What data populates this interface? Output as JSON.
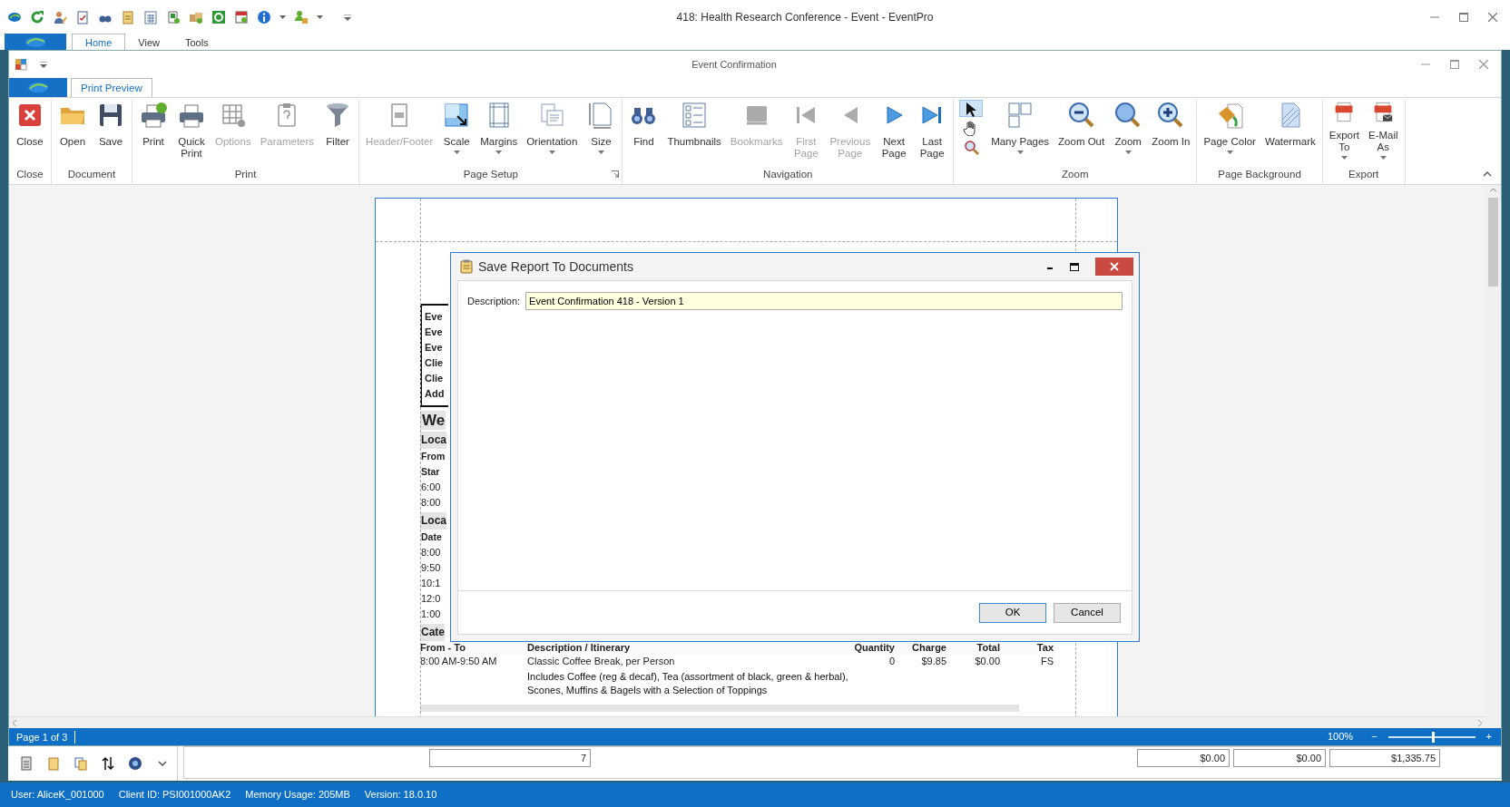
{
  "app": {
    "title": "418: Health Research Conference - Event - EventPro",
    "tabs": [
      {
        "label": "Home",
        "selected": true
      },
      {
        "label": "View",
        "selected": false
      },
      {
        "label": "Tools",
        "selected": false
      }
    ]
  },
  "window": {
    "title": "Event Confirmation",
    "tabs": [
      {
        "label": "Print Preview",
        "selected": true
      }
    ]
  },
  "ribbon": {
    "groups": [
      {
        "label": "Close",
        "launcher": false,
        "buttons": [
          {
            "kind": "large",
            "label": "Close",
            "disabled": false,
            "dropdown": false
          }
        ]
      },
      {
        "label": "Document",
        "launcher": false,
        "buttons": [
          {
            "kind": "large",
            "label": "Open",
            "disabled": false,
            "dropdown": false
          },
          {
            "kind": "large",
            "label": "Save",
            "disabled": false,
            "dropdown": false
          }
        ]
      },
      {
        "label": "Print",
        "launcher": false,
        "buttons": [
          {
            "kind": "large",
            "label": "Print",
            "disabled": false,
            "dropdown": false
          },
          {
            "kind": "large",
            "label": "Quick\nPrint",
            "disabled": false,
            "dropdown": false
          },
          {
            "kind": "large",
            "label": "Options",
            "disabled": true,
            "dropdown": false
          },
          {
            "kind": "large",
            "label": "Parameters",
            "disabled": true,
            "dropdown": false
          },
          {
            "kind": "large",
            "label": "Filter",
            "disabled": false,
            "dropdown": false
          }
        ]
      },
      {
        "label": "Page Setup",
        "launcher": true,
        "buttons": [
          {
            "kind": "large",
            "label": "Header/Footer",
            "disabled": true,
            "dropdown": false
          },
          {
            "kind": "large",
            "label": "Scale",
            "disabled": false,
            "dropdown": true
          },
          {
            "kind": "large",
            "label": "Margins",
            "disabled": false,
            "dropdown": true
          },
          {
            "kind": "large",
            "label": "Orientation",
            "disabled": false,
            "dropdown": true
          },
          {
            "kind": "large",
            "label": "Size",
            "disabled": false,
            "dropdown": true
          }
        ]
      },
      {
        "label": "Navigation",
        "launcher": false,
        "buttons": [
          {
            "kind": "large",
            "label": "Find",
            "disabled": false,
            "dropdown": false
          },
          {
            "kind": "large",
            "label": "Thumbnails",
            "disabled": false,
            "dropdown": false
          },
          {
            "kind": "large",
            "label": "Bookmarks",
            "disabled": true,
            "dropdown": false
          },
          {
            "kind": "large",
            "label": "First\nPage",
            "disabled": true,
            "dropdown": false
          },
          {
            "kind": "large",
            "label": "Previous\nPage",
            "disabled": true,
            "dropdown": false
          },
          {
            "kind": "large",
            "label": "Next\nPage",
            "disabled": false,
            "dropdown": false
          },
          {
            "kind": "large",
            "label": "Last\nPage",
            "disabled": false,
            "dropdown": false
          }
        ]
      },
      {
        "label": "Zoom",
        "launcher": false,
        "buttons": [
          {
            "kind": "tools",
            "tools": [
              {
                "selected": true
              },
              {
                "selected": false
              },
              {
                "selected": false
              }
            ]
          },
          {
            "kind": "large",
            "label": "Many Pages",
            "disabled": false,
            "dropdown": true
          },
          {
            "kind": "large",
            "label": "Zoom Out",
            "disabled": false,
            "dropdown": false
          },
          {
            "kind": "large",
            "label": "Zoom",
            "disabled": false,
            "dropdown": true
          },
          {
            "kind": "large",
            "label": "Zoom In",
            "disabled": false,
            "dropdown": false
          }
        ]
      },
      {
        "label": "Page Background",
        "launcher": false,
        "buttons": [
          {
            "kind": "large",
            "label": "Page Color",
            "disabled": false,
            "dropdown": true
          },
          {
            "kind": "large",
            "label": "Watermark",
            "disabled": false,
            "dropdown": false
          }
        ]
      },
      {
        "label": "Export",
        "launcher": false,
        "buttons": [
          {
            "kind": "large",
            "label": "Export\nTo",
            "disabled": false,
            "dropdown": true
          },
          {
            "kind": "large",
            "label": "E-Mail\nAs",
            "disabled": false,
            "dropdown": true
          }
        ]
      }
    ]
  },
  "page": {
    "info_box": [
      "Eve",
      "Eve",
      "Eve",
      "Clie",
      "Clie",
      "Add"
    ],
    "section": "We",
    "lines": [
      {
        "kind": "subheading",
        "text": "Loca"
      },
      {
        "kind": "label",
        "text": "From"
      },
      {
        "kind": "label",
        "text": "Star"
      },
      {
        "kind": "plain",
        "text": "6:00"
      },
      {
        "kind": "plain",
        "text": "8:00"
      },
      {
        "kind": "subheading",
        "text": "Loca"
      },
      {
        "kind": "label",
        "text": "Date"
      },
      {
        "kind": "plain",
        "text": "8:00"
      },
      {
        "kind": "plain",
        "text": "9:50"
      },
      {
        "kind": "plain",
        "text": "10:1"
      },
      {
        "kind": "plain",
        "text": "12:0"
      },
      {
        "kind": "plain",
        "text": "1:00"
      },
      {
        "kind": "subheading",
        "text": "Cate"
      }
    ],
    "table": {
      "columns": [
        "From - To",
        "Description / Itinerary",
        "Quantity",
        "Charge",
        "Total",
        "Tax"
      ],
      "rows": [
        {
          "cells": [
            "8:00 AM-9:50 AM",
            "Classic Coffee Break, per Person",
            "0",
            "$9.85",
            "$0.00",
            "FS"
          ],
          "note": "Includes Coffee (reg & decaf), Tea (assortment of black, green & herbal),\nScones, Muffins & Bagels with a Selection of Toppings"
        }
      ]
    }
  },
  "dialog": {
    "title": "Save Report To Documents",
    "field": {
      "label": "Description:",
      "value": "Event Confirmation 418 - Version 1"
    },
    "buttons": [
      {
        "label": "OK",
        "default": true
      },
      {
        "label": "Cancel",
        "default": false
      }
    ]
  },
  "status_bar": {
    "page": "Page 1 of 3",
    "zoom": "100%",
    "zoom_out": "−",
    "zoom_in": "+",
    "level": 0.5
  },
  "bottom_table": {
    "cells": [
      "7",
      "$0.00",
      "$0.00",
      "$1,335.75"
    ]
  },
  "app_status": [
    "User: AliceK_001000",
    "Client ID: PSI001000AK2",
    "Memory Usage: 205MB",
    "Version: 18.0.10"
  ]
}
